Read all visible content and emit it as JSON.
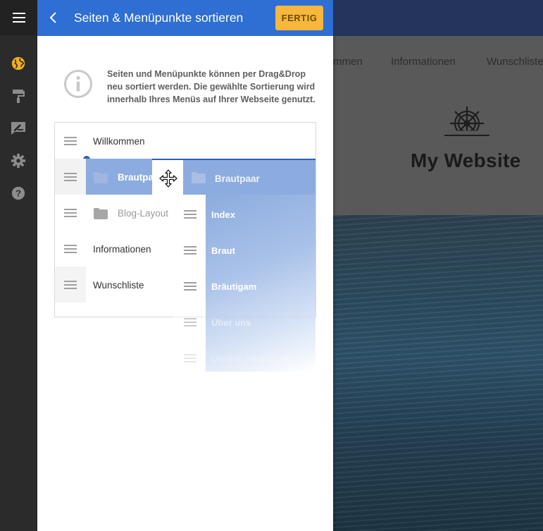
{
  "rail": {
    "menu_icon": "hamburger-icon",
    "items": [
      {
        "name": "globe-icon",
        "active": true,
        "color": "#f2b01e"
      },
      {
        "name": "paint-roller-icon",
        "active": false,
        "color": "#8c8c8c"
      },
      {
        "name": "edit-sign-icon",
        "active": false,
        "color": "#8c8c8c"
      },
      {
        "name": "gear-icon",
        "active": false,
        "color": "#8c8c8c"
      },
      {
        "name": "help-icon",
        "active": false,
        "color": "#8c8c8c"
      }
    ]
  },
  "header": {
    "title": "Seiten & Menüpunkte sortieren",
    "done_label": "FERTIG",
    "back_icon": "chevron-left-icon",
    "accent_color": "#2f6ed2",
    "done_color": "#f6b73c"
  },
  "info": {
    "icon": "info-circle-icon",
    "text": "Seiten und Menüpunkte können per Drag&Drop neu sortiert werden. Die gewählte Sortierung wird innerhalb Ihres Menüs auf Ihrer Webseite genutzt."
  },
  "menu_list": {
    "items": [
      {
        "label": "Willkommen",
        "type": "page"
      },
      {
        "label": "Brautpaar",
        "type": "folder",
        "state": "dragging"
      },
      {
        "label": "Blog-Layout",
        "type": "folder"
      },
      {
        "label": "Informationen",
        "type": "page"
      },
      {
        "label": "Wunschliste",
        "type": "page"
      }
    ]
  },
  "drag_ghost": {
    "label": "Brautpaar",
    "children": [
      "Index",
      "Braut",
      "Bräutigam",
      "Über uns",
      "Unsere Geschichte"
    ]
  },
  "preview": {
    "nav": [
      "Willkommen",
      "Informationen",
      "Wunschliste"
    ],
    "site_title": "My Website",
    "logo_icon": "ship-wheel-icon"
  }
}
